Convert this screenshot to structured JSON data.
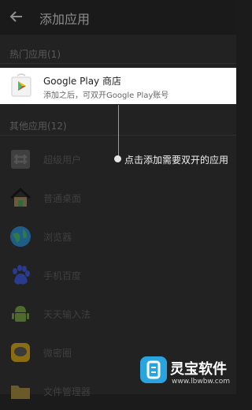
{
  "appbar": {
    "title": "添加应用",
    "back_icon": "arrow-left-icon"
  },
  "sections": {
    "popular": "热门应用(1)",
    "other": "其他应用(12)"
  },
  "featured": {
    "name": "Google Play 商店",
    "subtitle": "添加之后，可双开Google Play账号",
    "icon": "google-play-icon"
  },
  "apps": [
    {
      "label": "超级用户",
      "icon": "superuser-icon"
    },
    {
      "label": "普通桌面",
      "icon": "home-icon"
    },
    {
      "label": "浏览器",
      "icon": "globe-icon"
    },
    {
      "label": "手机百度",
      "icon": "baidu-paw-icon"
    },
    {
      "label": "天天输入法",
      "icon": "android-icon"
    },
    {
      "label": "微密圈",
      "icon": "chat-icon"
    },
    {
      "label": "文件管理器",
      "icon": "folder-icon"
    }
  ],
  "callout": {
    "text": "点击添加需要双开的应用"
  },
  "watermark": {
    "name": "灵宝软件",
    "url": "www.lbwbw.com"
  },
  "colors": {
    "dim_overlay_bg": "#222222",
    "featured_bg": "#ffffff",
    "watermark_badge": "#29a4df"
  }
}
